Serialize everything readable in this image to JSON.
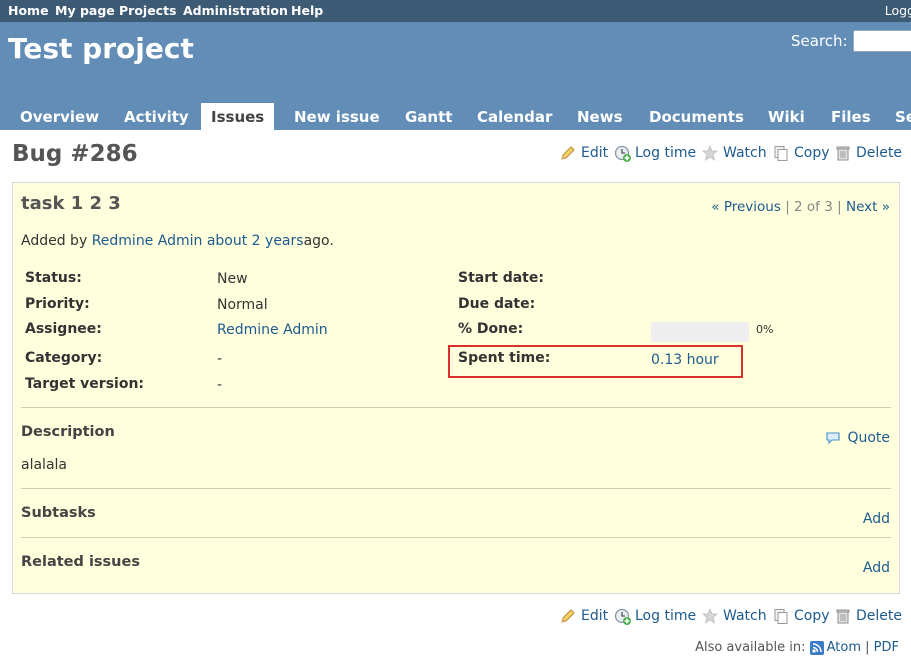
{
  "top_menu": {
    "items": [
      "Home",
      "My page",
      "Projects",
      "Administration",
      "Help"
    ],
    "logged": "Logg"
  },
  "header": {
    "project_title": "Test project",
    "search_label": "Search:",
    "search_value": ""
  },
  "tabs": [
    {
      "label": "Overview",
      "selected": false
    },
    {
      "label": "Activity",
      "selected": false
    },
    {
      "label": "Issues",
      "selected": true
    },
    {
      "label": "New issue",
      "selected": false
    },
    {
      "label": "Gantt",
      "selected": false
    },
    {
      "label": "Calendar",
      "selected": false
    },
    {
      "label": "News",
      "selected": false
    },
    {
      "label": "Documents",
      "selected": false
    },
    {
      "label": "Wiki",
      "selected": false
    },
    {
      "label": "Files",
      "selected": false
    },
    {
      "label": "Se",
      "selected": false
    }
  ],
  "page_title": "Bug #286",
  "actions": {
    "edit": "Edit",
    "log_time": "Log time",
    "watch": "Watch",
    "copy": "Copy",
    "delete": "Delete"
  },
  "issue": {
    "subject": "task 1 2 3",
    "nav": {
      "previous": "« Previous",
      "separator": "|",
      "position": "2 of 3",
      "next": "Next »"
    },
    "author": {
      "prefix": "Added by",
      "name": "Redmine Admin",
      "time": "about 2 years",
      "suffix": "ago."
    },
    "attributes": {
      "status": {
        "label": "Status:",
        "value": "New"
      },
      "priority": {
        "label": "Priority:",
        "value": "Normal"
      },
      "assignee": {
        "label": "Assignee:",
        "value": "Redmine Admin"
      },
      "category": {
        "label": "Category:",
        "value": "-"
      },
      "target_version": {
        "label": "Target version:",
        "value": "-"
      },
      "start_date": {
        "label": "Start date:",
        "value": ""
      },
      "due_date": {
        "label": "Due date:",
        "value": ""
      },
      "done": {
        "label": "% Done:",
        "value": "0%",
        "percent": 0
      },
      "spent_time": {
        "label": "Spent time:",
        "value": "0.13 hour"
      }
    },
    "description": {
      "title": "Description",
      "quote": "Quote",
      "text": "alalala"
    },
    "subtasks": {
      "title": "Subtasks",
      "add": "Add"
    },
    "related": {
      "title": "Related issues",
      "add": "Add"
    }
  },
  "footer": {
    "also_available": "Also available in:",
    "atom": "Atom",
    "separator": "|",
    "pdf": "PDF"
  },
  "icons": {
    "edit": "pencil-icon",
    "log_time": "clock-add-icon",
    "watch": "star-icon",
    "copy": "copy-icon",
    "delete": "trash-icon",
    "quote": "comment-icon",
    "atom": "feed-icon"
  },
  "colors": {
    "top_menu_bg": "#3e5b76",
    "header_bg": "#628db6",
    "issue_bg": "#ffffdd",
    "link": "#1d5a8e",
    "highlight": "#d9312a"
  }
}
